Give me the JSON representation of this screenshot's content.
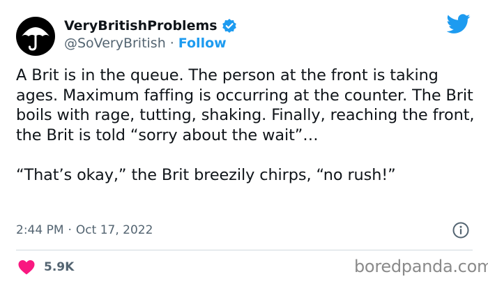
{
  "account": {
    "display_name": "VeryBritishProblems",
    "handle": "@SoVeryBritish",
    "separator": "·",
    "follow_label": "Follow"
  },
  "tweet": {
    "text": "A Brit is in the queue. The person at the front is taking ages. Maximum faffing is occurring at the counter. The Brit boils with rage, tutting, shaking. Finally, reaching the front, the Brit is told “sorry about the wait”…\n\n“That’s okay,” the Brit breezily chirps, “no rush!”",
    "time": "2:44 PM",
    "separator": "·",
    "date": "Oct 17, 2022",
    "like_count": "5.9K"
  },
  "watermark": "boredpanda.com",
  "icons": {
    "avatar": "umbrella-avatar",
    "verified": "verified-badge-icon",
    "brand": "twitter-bird-icon",
    "info": "info-icon",
    "like": "heart-icon"
  },
  "colors": {
    "text": "#0f1419",
    "secondary": "#536471",
    "accent": "#1d9bf0",
    "heart": "#f91880",
    "watermark": "#8a8a8a"
  }
}
